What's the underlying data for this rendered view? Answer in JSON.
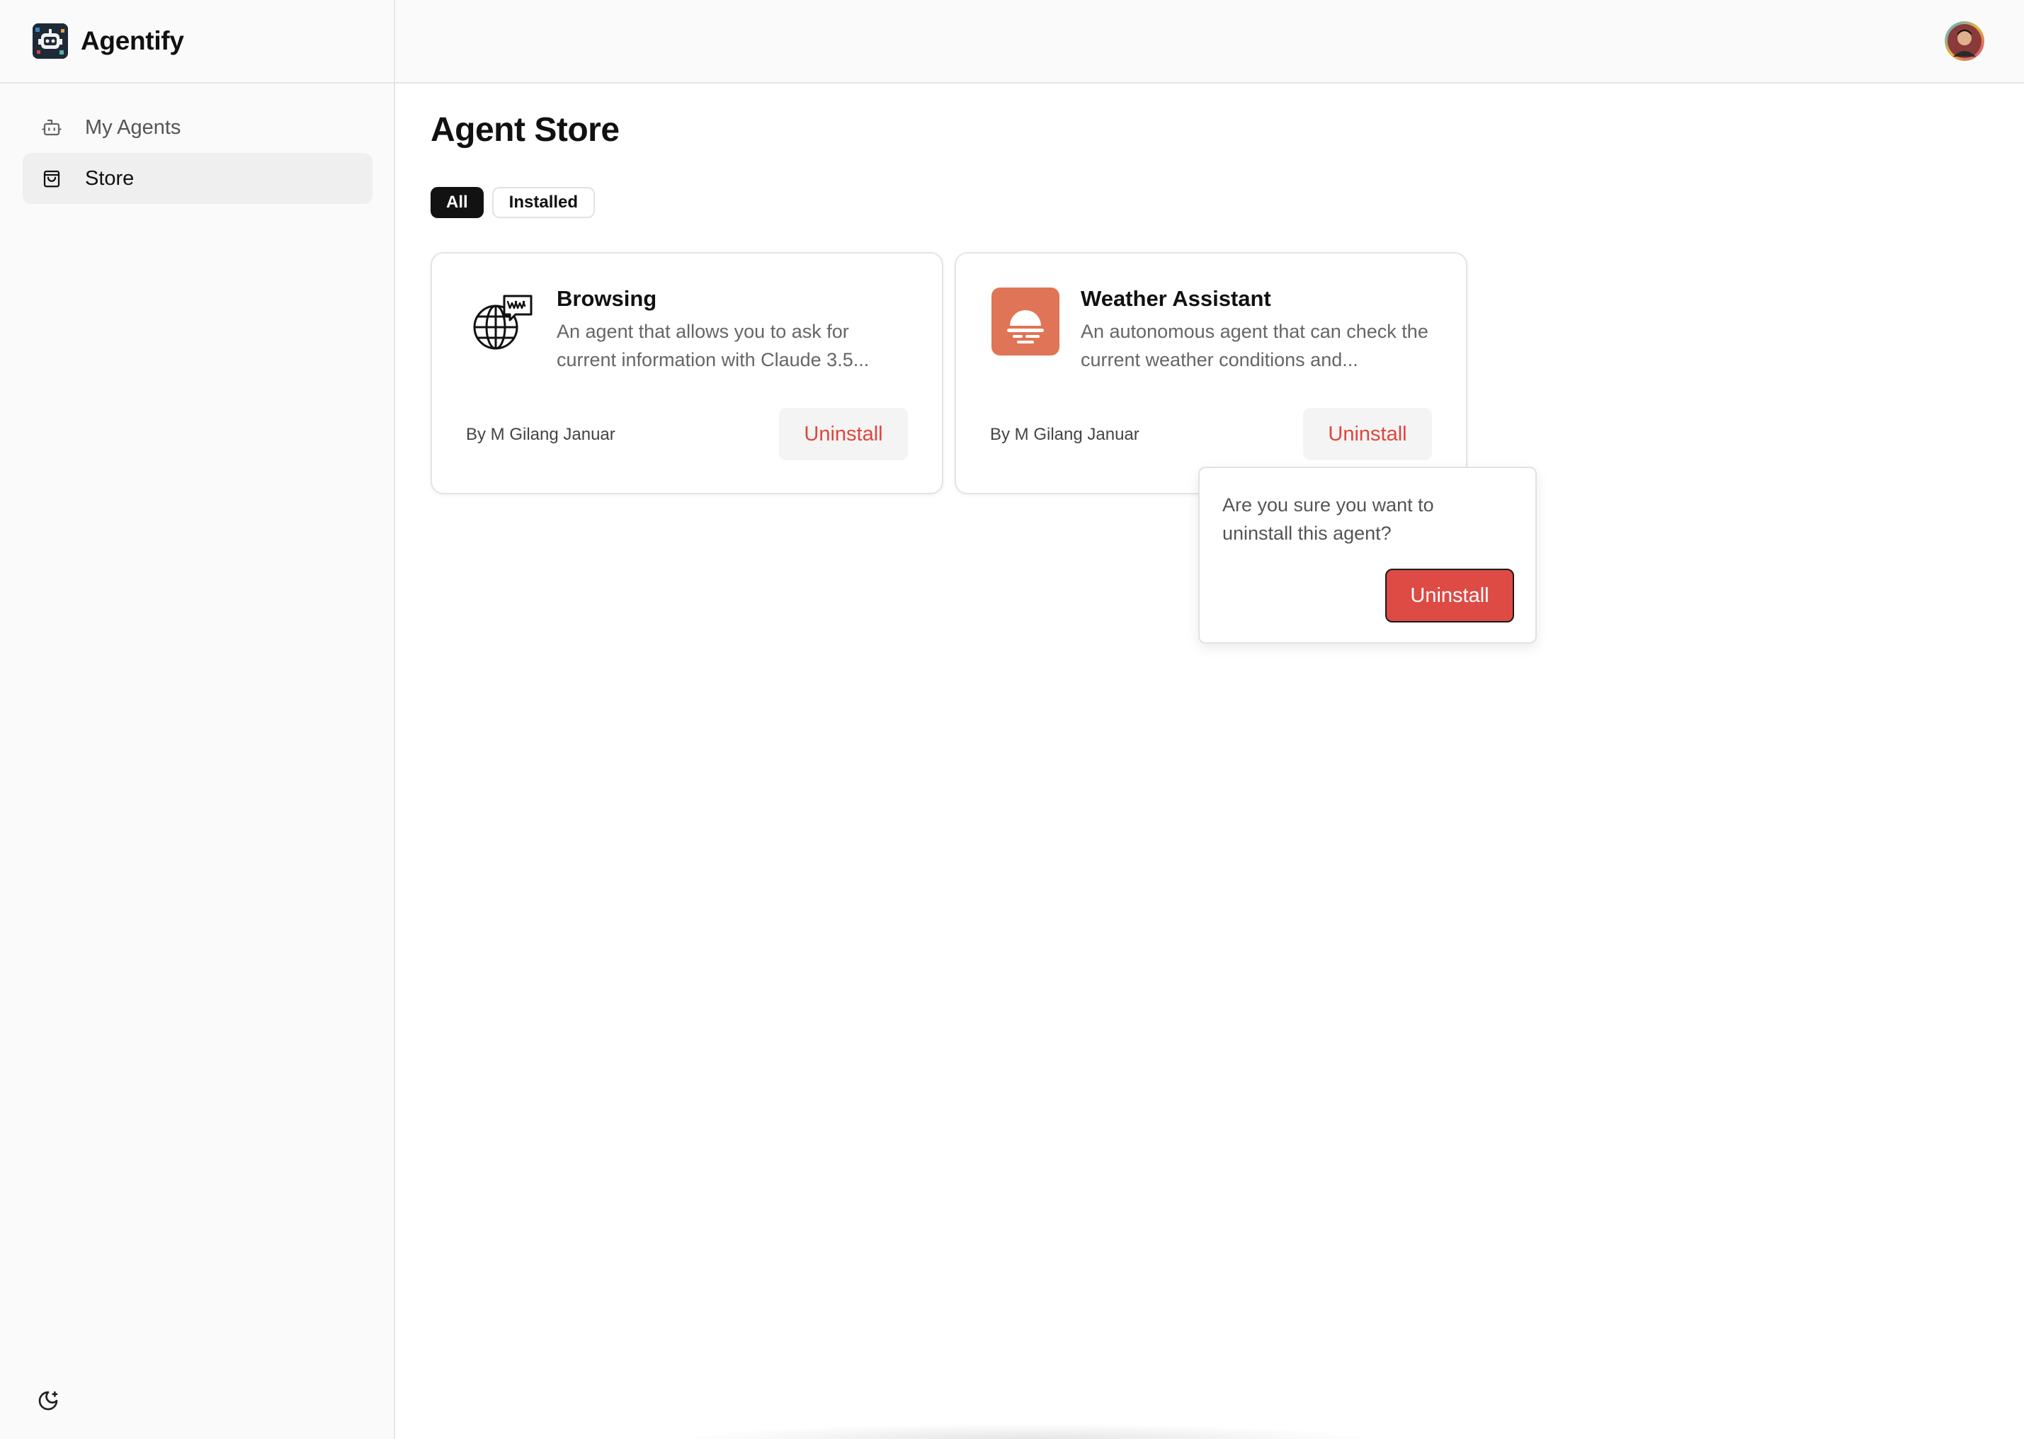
{
  "app": {
    "name": "Agentify"
  },
  "sidebar": {
    "items": [
      {
        "label": "My Agents",
        "icon": "robot-icon",
        "active": false
      },
      {
        "label": "Store",
        "icon": "shopping-bag-icon",
        "active": true
      }
    ],
    "theme_toggle_icon": "moon-icon"
  },
  "header": {
    "avatar": "user-avatar"
  },
  "main": {
    "title": "Agent Store",
    "tabs": [
      {
        "label": "All",
        "active": true
      },
      {
        "label": "Installed",
        "active": false
      }
    ],
    "agents": [
      {
        "name": "Browsing",
        "description": "An agent that allows you to ask for current information with Claude 3.5...",
        "author": "By M Gilang Januar",
        "action": "Uninstall",
        "icon": "globe-chat-icon"
      },
      {
        "name": "Weather Assistant",
        "description": "An autonomous agent that can check the current weather conditions and...",
        "author": "By M Gilang Januar",
        "action": "Uninstall",
        "icon": "sunset-icon"
      }
    ]
  },
  "popover": {
    "message": "Are you sure you want to uninstall this agent?",
    "confirm_label": "Uninstall"
  },
  "colors": {
    "accent_red": "#de4a44",
    "weather_icon_bg": "#e07456",
    "active_tab": "#121212"
  }
}
